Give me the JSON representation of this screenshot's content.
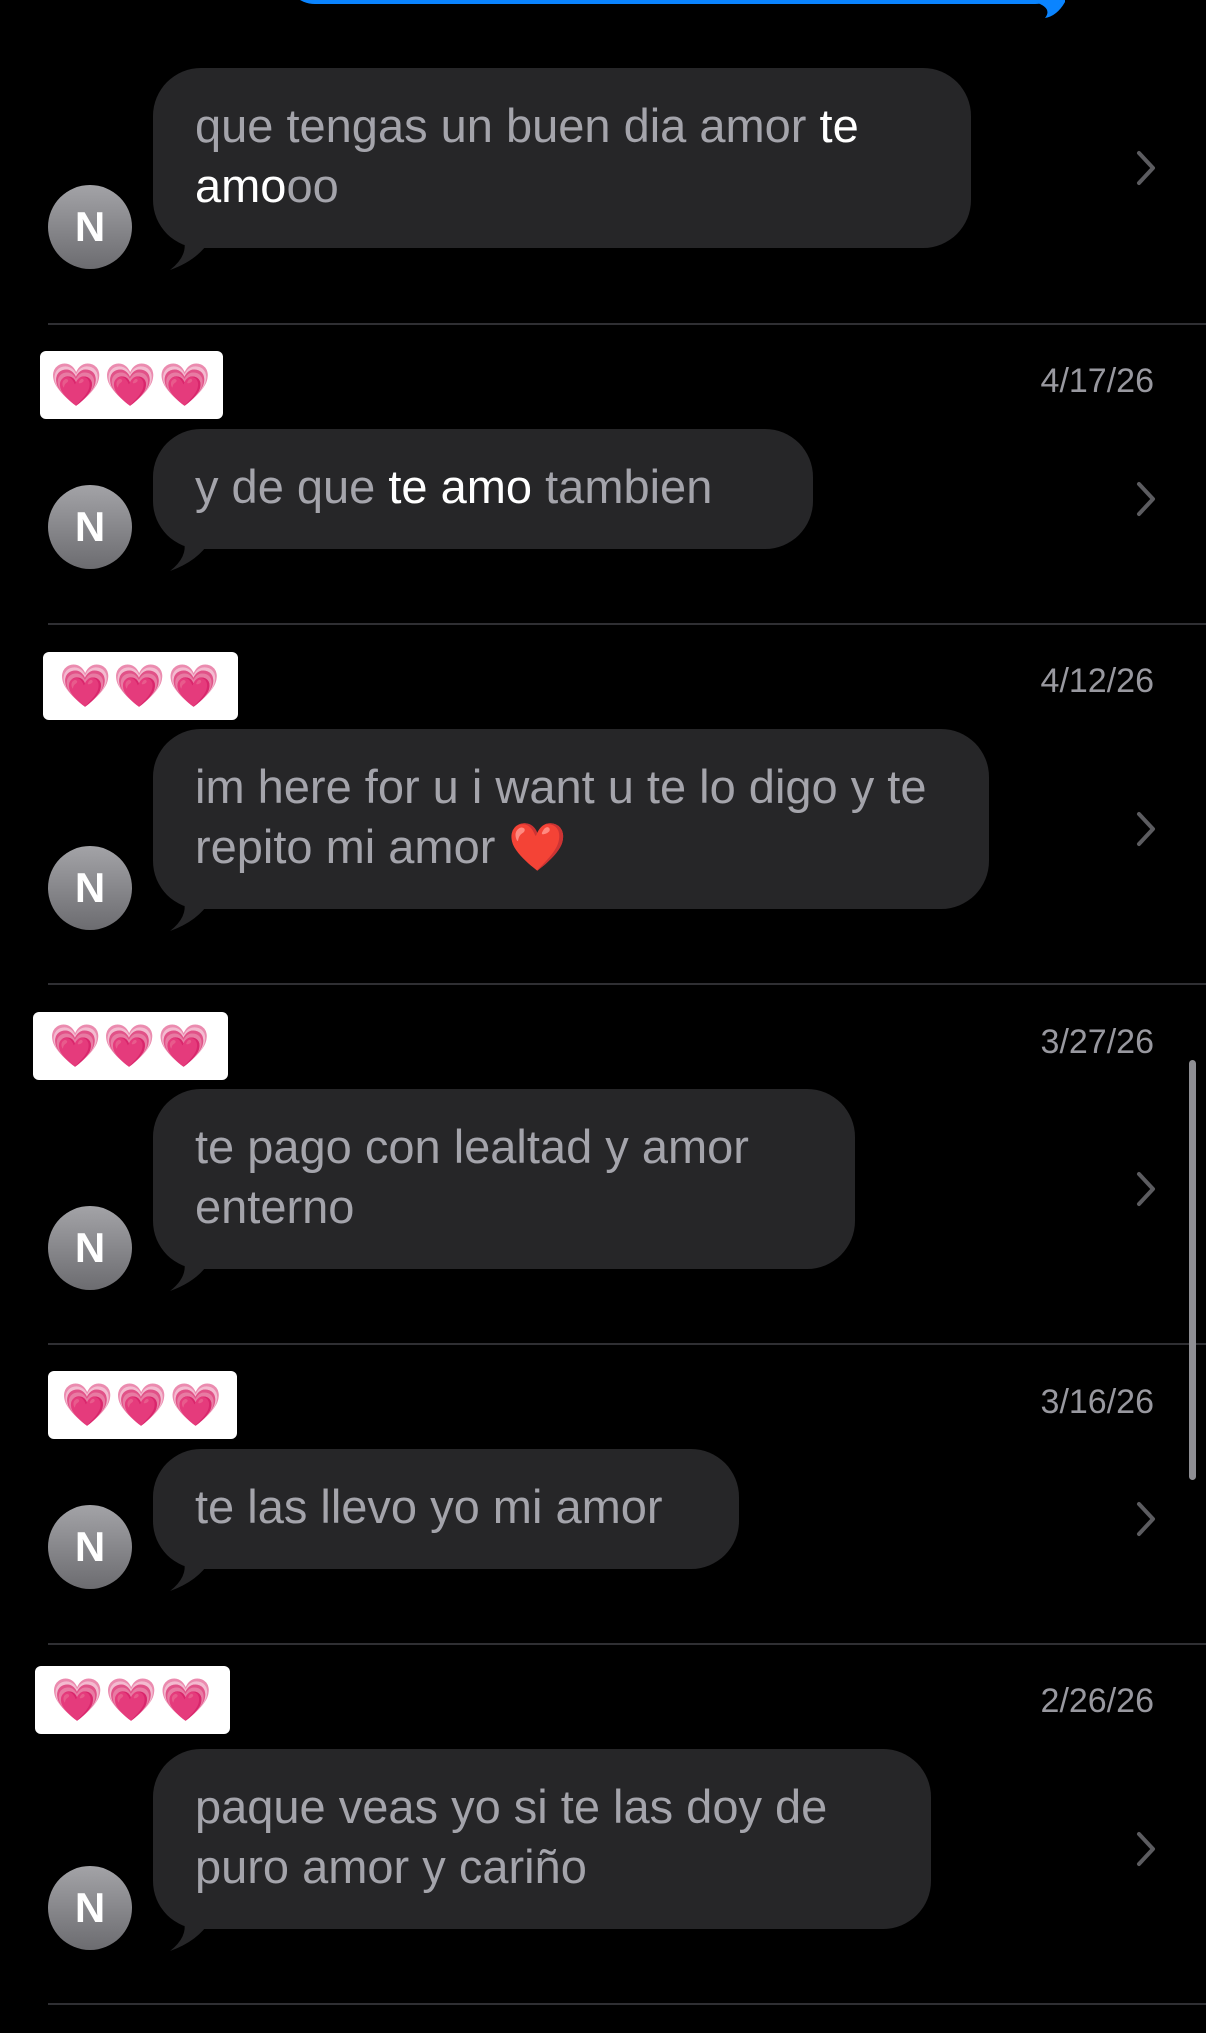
{
  "top_bubble_color": "#0a84ff",
  "results": [
    {
      "sender": "",
      "date": "",
      "avatar_initial": "N",
      "message_parts": [
        {
          "text": "que tengas un buen dia amor ",
          "highlight": false
        },
        {
          "text": "te amo",
          "highlight": true
        },
        {
          "text": "oo",
          "highlight": false
        }
      ]
    },
    {
      "sender": "💗💗💗",
      "date": "4/17/26",
      "avatar_initial": "N",
      "message_parts": [
        {
          "text": "y de que ",
          "highlight": false
        },
        {
          "text": "te amo",
          "highlight": true
        },
        {
          "text": " tambien",
          "highlight": false
        }
      ]
    },
    {
      "sender": "💗💗💗",
      "date": "4/12/26",
      "avatar_initial": "N",
      "message_parts": [
        {
          "text": "im here for u i want u te lo digo y te repito mi amor ❤️",
          "highlight": false
        }
      ]
    },
    {
      "sender": "💗💗💗",
      "date": "3/27/26",
      "avatar_initial": "N",
      "message_parts": [
        {
          "text": "te pago con lealtad y amor enterno",
          "highlight": false
        }
      ]
    },
    {
      "sender": "💗💗💗",
      "date": "3/16/26",
      "avatar_initial": "N",
      "message_parts": [
        {
          "text": "te las llevo yo mi amor",
          "highlight": false
        }
      ]
    },
    {
      "sender": "💗💗💗",
      "date": "2/26/26",
      "avatar_initial": "N",
      "message_parts": [
        {
          "text": "paque veas yo si te las doy de puro amor y cariño",
          "highlight": false
        }
      ]
    }
  ],
  "icons": {
    "chevron": "chevron-right-icon",
    "avatar": "contact-avatar"
  }
}
